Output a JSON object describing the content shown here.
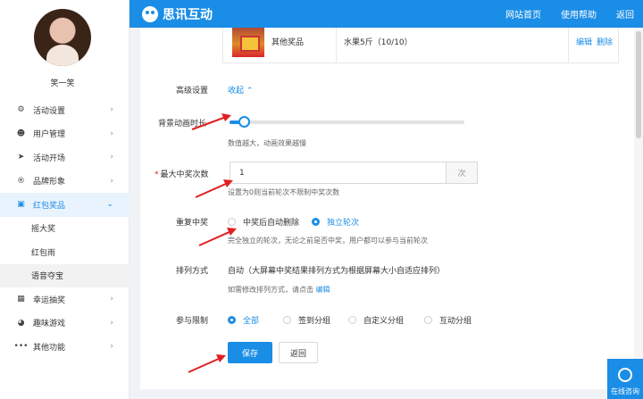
{
  "sidebar": {
    "username": "笑一笑",
    "items": [
      {
        "label": "活动设置",
        "icon": "gear-icon"
      },
      {
        "label": "用户管理",
        "icon": "users-icon"
      },
      {
        "label": "活动开场",
        "icon": "send-icon"
      },
      {
        "label": "品牌形象",
        "icon": "registered-icon"
      },
      {
        "label": "红包奖品",
        "icon": "gift-icon"
      },
      {
        "label": "幸运抽奖",
        "icon": "grid-icon"
      },
      {
        "label": "趣味游戏",
        "icon": "palette-icon"
      },
      {
        "label": "其他功能",
        "icon": "more-icon"
      }
    ],
    "sub_items": [
      "摇大奖",
      "红包雨",
      "语音夺宝"
    ]
  },
  "header": {
    "brand": "思讯互动",
    "nav": [
      "网站首页",
      "使用帮助",
      "返回"
    ]
  },
  "prize_row": {
    "type": "其他奖品",
    "name": "水果5斤（10/10）",
    "edit": "编辑",
    "delete": "删除"
  },
  "advanced": {
    "label": "高级设置",
    "toggle": "收起"
  },
  "bg_anim": {
    "label": "背景动画时长",
    "hint": "数值越大，动画效果越慢",
    "value_fraction": 0.06
  },
  "max_wins": {
    "label": "最大中奖次数",
    "value": "1",
    "suffix": "次",
    "hint": "设置为0则当前轮次不限制中奖次数"
  },
  "repeat_win": {
    "label": "重复中奖",
    "options": [
      "中奖后自动删除",
      "独立轮次"
    ],
    "selected": 1,
    "hint": "完全独立的轮次，无论之前是否中奖，用户都可以参与当前轮次"
  },
  "sort_mode": {
    "label": "排列方式",
    "value": "自动（大屏幕中奖结果排列方式为根据屏幕大小自适应排列）",
    "hint": "如需修改排列方式，请点击",
    "hint_link": "编辑"
  },
  "participation": {
    "label": "参与限制",
    "options": [
      "全部",
      "签到分组",
      "自定义分组",
      "互动分组"
    ],
    "selected": 0
  },
  "buttons": {
    "save": "保存",
    "back": "返回"
  },
  "help_widget": {
    "label": "在线咨询"
  },
  "colors": {
    "accent": "#1a8de6",
    "required": "#e02020"
  }
}
